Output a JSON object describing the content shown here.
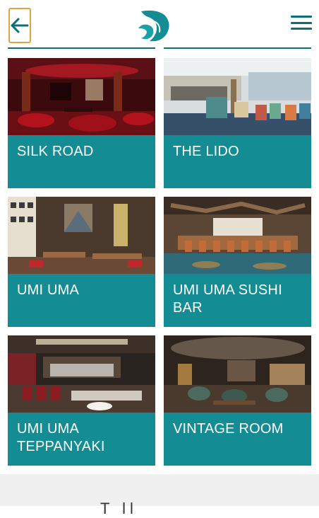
{
  "header": {
    "back_icon": "arrow-left-icon",
    "logo_icon": "wave-logo-icon",
    "menu_icon": "hamburger-menu-icon"
  },
  "colors": {
    "accent": "#138c93",
    "teal_dark": "#0d6e78",
    "back_border": "#e0a43a"
  },
  "venues": [
    {
      "title": "SILK ROAD"
    },
    {
      "title": "THE LIDO"
    },
    {
      "title": "UMI UMA"
    },
    {
      "title": "UMI UMA SUSHI BAR"
    },
    {
      "title": "UMI UMA TEPPANYAKI"
    },
    {
      "title": "VINTAGE ROOM"
    }
  ],
  "footer": {
    "text": "T  ll"
  }
}
